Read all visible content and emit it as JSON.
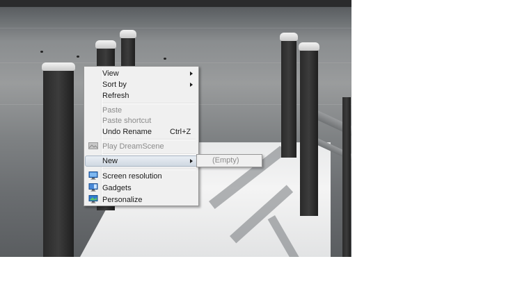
{
  "context_menu": {
    "items": [
      {
        "label": "View",
        "submenu": true
      },
      {
        "label": "Sort by",
        "submenu": true
      },
      {
        "label": "Refresh"
      },
      {
        "label": "Paste",
        "disabled": true
      },
      {
        "label": "Paste shortcut",
        "disabled": true
      },
      {
        "label": "Undo Rename",
        "shortcut": "Ctrl+Z"
      },
      {
        "label": "Play DreamScene",
        "disabled": true,
        "icon": "dreamscene-icon"
      },
      {
        "label": "New",
        "submenu": true,
        "highlighted": true
      },
      {
        "label": "Screen resolution",
        "icon": "monitor-icon"
      },
      {
        "label": "Gadgets",
        "icon": "gadgets-icon"
      },
      {
        "label": "Personalize",
        "icon": "personalize-icon"
      }
    ]
  },
  "new_submenu": {
    "items": [
      {
        "label": "(Empty)",
        "disabled": true
      }
    ]
  },
  "colors": {
    "menu_background": "#f0f0f0",
    "menu_border": "#979797",
    "disabled_text": "#8b8b8b",
    "highlight": "#cfd8e2"
  }
}
